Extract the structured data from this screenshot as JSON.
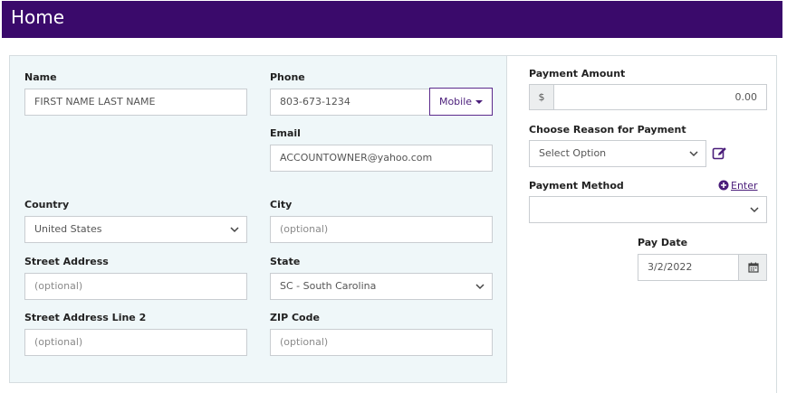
{
  "header": {
    "title": "Home"
  },
  "contact": {
    "name": {
      "label": "Name",
      "value": "FIRST NAME LAST NAME"
    },
    "phone": {
      "label": "Phone",
      "value": "803-673-1234",
      "type_label": "Mobile"
    },
    "email": {
      "label": "Email",
      "value": "ACCOUNTOWNER@yahoo.com"
    },
    "country": {
      "label": "Country",
      "value": "United States"
    },
    "city": {
      "label": "City",
      "placeholder": "(optional)"
    },
    "street": {
      "label": "Street Address",
      "placeholder": "(optional)"
    },
    "state": {
      "label": "State",
      "value": "SC - South Carolina"
    },
    "street2": {
      "label": "Street Address Line 2",
      "placeholder": "(optional)"
    },
    "zip": {
      "label": "ZIP Code",
      "placeholder": "(optional)"
    }
  },
  "payment": {
    "amount": {
      "label": "Payment Amount",
      "currency": "$",
      "value": "0.00"
    },
    "reason": {
      "label": "Choose Reason for Payment",
      "value": "Select Option"
    },
    "method": {
      "label": "Payment Method",
      "enter_label": "Enter",
      "value": ""
    },
    "pay_date": {
      "label": "Pay Date",
      "value": "3/2/2022"
    }
  },
  "colors": {
    "header_bg": "#3a0a6b",
    "accent": "#4a1d7a",
    "panel_bg": "#eff7f9"
  },
  "icons": [
    "chevron-down-icon",
    "caret-down-icon",
    "edit-icon",
    "plus-circle-icon",
    "calendar-icon"
  ]
}
